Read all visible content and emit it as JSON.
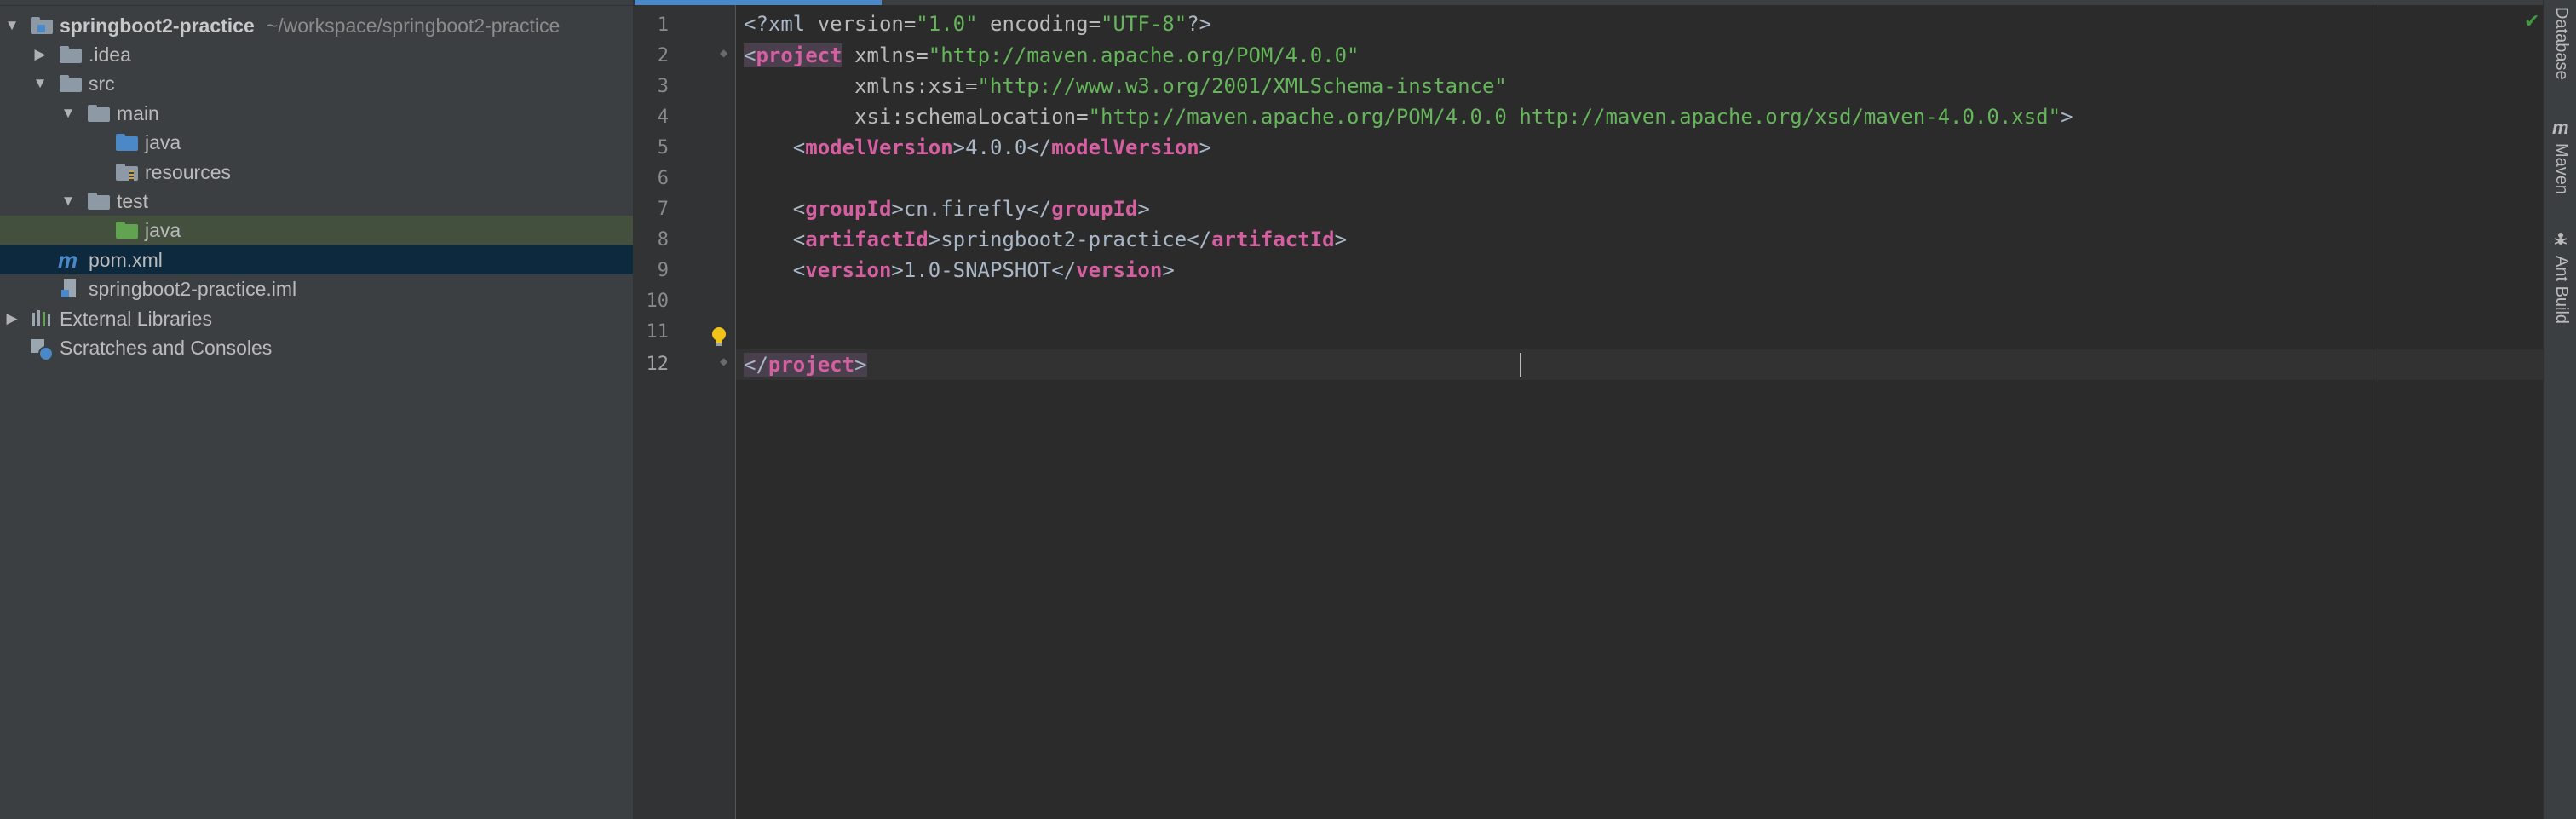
{
  "tree": {
    "root": {
      "name": "springboot2-practice",
      "path": "~/workspace/springboot2-practice"
    },
    "idea": ".idea",
    "src": "src",
    "main": "main",
    "main_java": "java",
    "resources": "resources",
    "test": "test",
    "test_java": "java",
    "pom": "pom.xml",
    "iml": "springboot2-practice.iml",
    "external": "External Libraries",
    "scratches": "Scratches and Consoles"
  },
  "editor": {
    "line_numbers": [
      "1",
      "2",
      "3",
      "4",
      "5",
      "6",
      "7",
      "8",
      "9",
      "10",
      "11",
      "12"
    ],
    "xml_decl": {
      "open": "<?xml ",
      "version_attr": "version=",
      "version_val": "\"1.0\"",
      "encoding_attr": " encoding=",
      "encoding_val": "\"UTF-8\"",
      "close": "?>"
    },
    "project_tag": "project",
    "xmlns_attr": "xmlns=",
    "xmlns_val": "\"http://maven.apache.org/POM/4.0.0\"",
    "xmlns_xsi_attr": "xmlns:xsi=",
    "xmlns_xsi_val": "\"http://www.w3.org/2001/XMLSchema-instance\"",
    "schema_attr": "xsi:schemaLocation=",
    "schema_val": "\"http://maven.apache.org/POM/4.0.0 http://maven.apache.org/xsd/maven-4.0.0.xsd\"",
    "model_version_tag": "modelVersion",
    "model_version": "4.0.0",
    "group_id_tag": "groupId",
    "group_id": "cn.firefly",
    "artifact_id_tag": "artifactId",
    "artifact_id": "springboot2-practice",
    "version_tag": "version",
    "version": "1.0-SNAPSHOT"
  },
  "tool_windows": [
    "Database",
    "Maven",
    "Ant Build"
  ],
  "colors": {
    "accent": "#4a88c7",
    "tag_name": "#d55fa1",
    "attr_value": "#65b65a",
    "selection": "#0d293e",
    "test_source_row": "#43503e"
  }
}
